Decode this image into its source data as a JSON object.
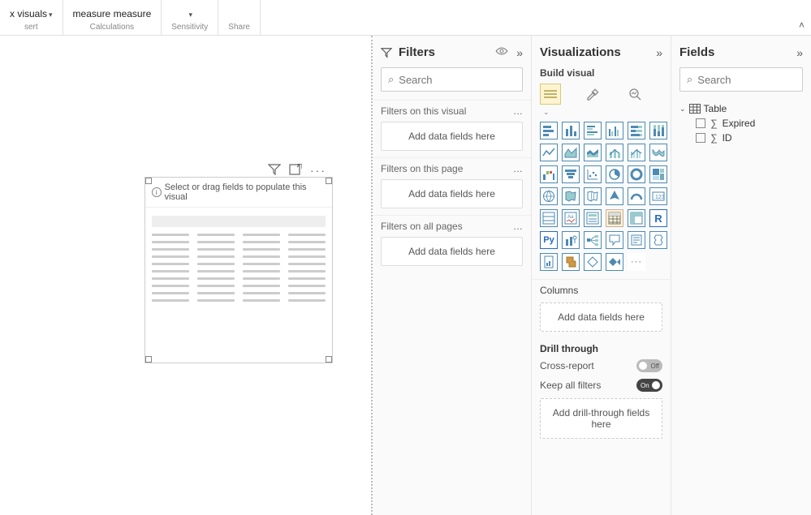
{
  "ribbon": {
    "group1_top": "x   visuals",
    "group1_label": "sert",
    "group2_top": "measure measure",
    "group2_label": "Calculations",
    "group3_label": "Sensitivity",
    "group4_label": "Share"
  },
  "canvas": {
    "hint": "Select or drag fields to populate this visual"
  },
  "filters": {
    "title": "Filters",
    "search_placeholder": "Search",
    "sections": [
      {
        "title": "Filters on this visual",
        "placeholder": "Add data fields here"
      },
      {
        "title": "Filters on this page",
        "placeholder": "Add data fields here"
      },
      {
        "title": "Filters on all pages",
        "placeholder": "Add data fields here"
      }
    ]
  },
  "viz": {
    "title": "Visualizations",
    "build_label": "Build visual",
    "columns_label": "Columns",
    "columns_placeholder": "Add data fields here",
    "drill_label": "Drill through",
    "cross_report_label": "Cross-report",
    "cross_report_state": "Off",
    "keep_filters_label": "Keep all filters",
    "keep_filters_state": "On",
    "drill_placeholder": "Add drill-through fields here"
  },
  "fields": {
    "title": "Fields",
    "search_placeholder": "Search",
    "table_name": "Table",
    "items": [
      {
        "name": "Expired"
      },
      {
        "name": "ID"
      }
    ]
  }
}
